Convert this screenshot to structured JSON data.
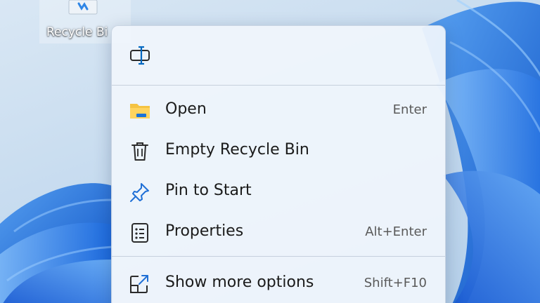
{
  "desktop": {
    "recycle_bin_label": "Recycle Bi"
  },
  "context_menu": {
    "quick_actions": [
      {
        "icon": "rename-icon"
      }
    ],
    "items": [
      {
        "label": "Open",
        "shortcut": "Enter",
        "icon": "folder-icon"
      },
      {
        "label": "Empty Recycle Bin",
        "shortcut": "",
        "icon": "trash-icon"
      },
      {
        "label": "Pin to Start",
        "shortcut": "",
        "icon": "pin-icon"
      },
      {
        "label": "Properties",
        "shortcut": "Alt+Enter",
        "icon": "properties-icon"
      },
      {
        "label": "Show more options",
        "shortcut": "Shift+F10",
        "icon": "show-more-icon"
      }
    ]
  },
  "colors": {
    "accent": "#0067c0",
    "folder_yellow": "#f5c342",
    "wallpaper_blue": "#1a6de0"
  }
}
